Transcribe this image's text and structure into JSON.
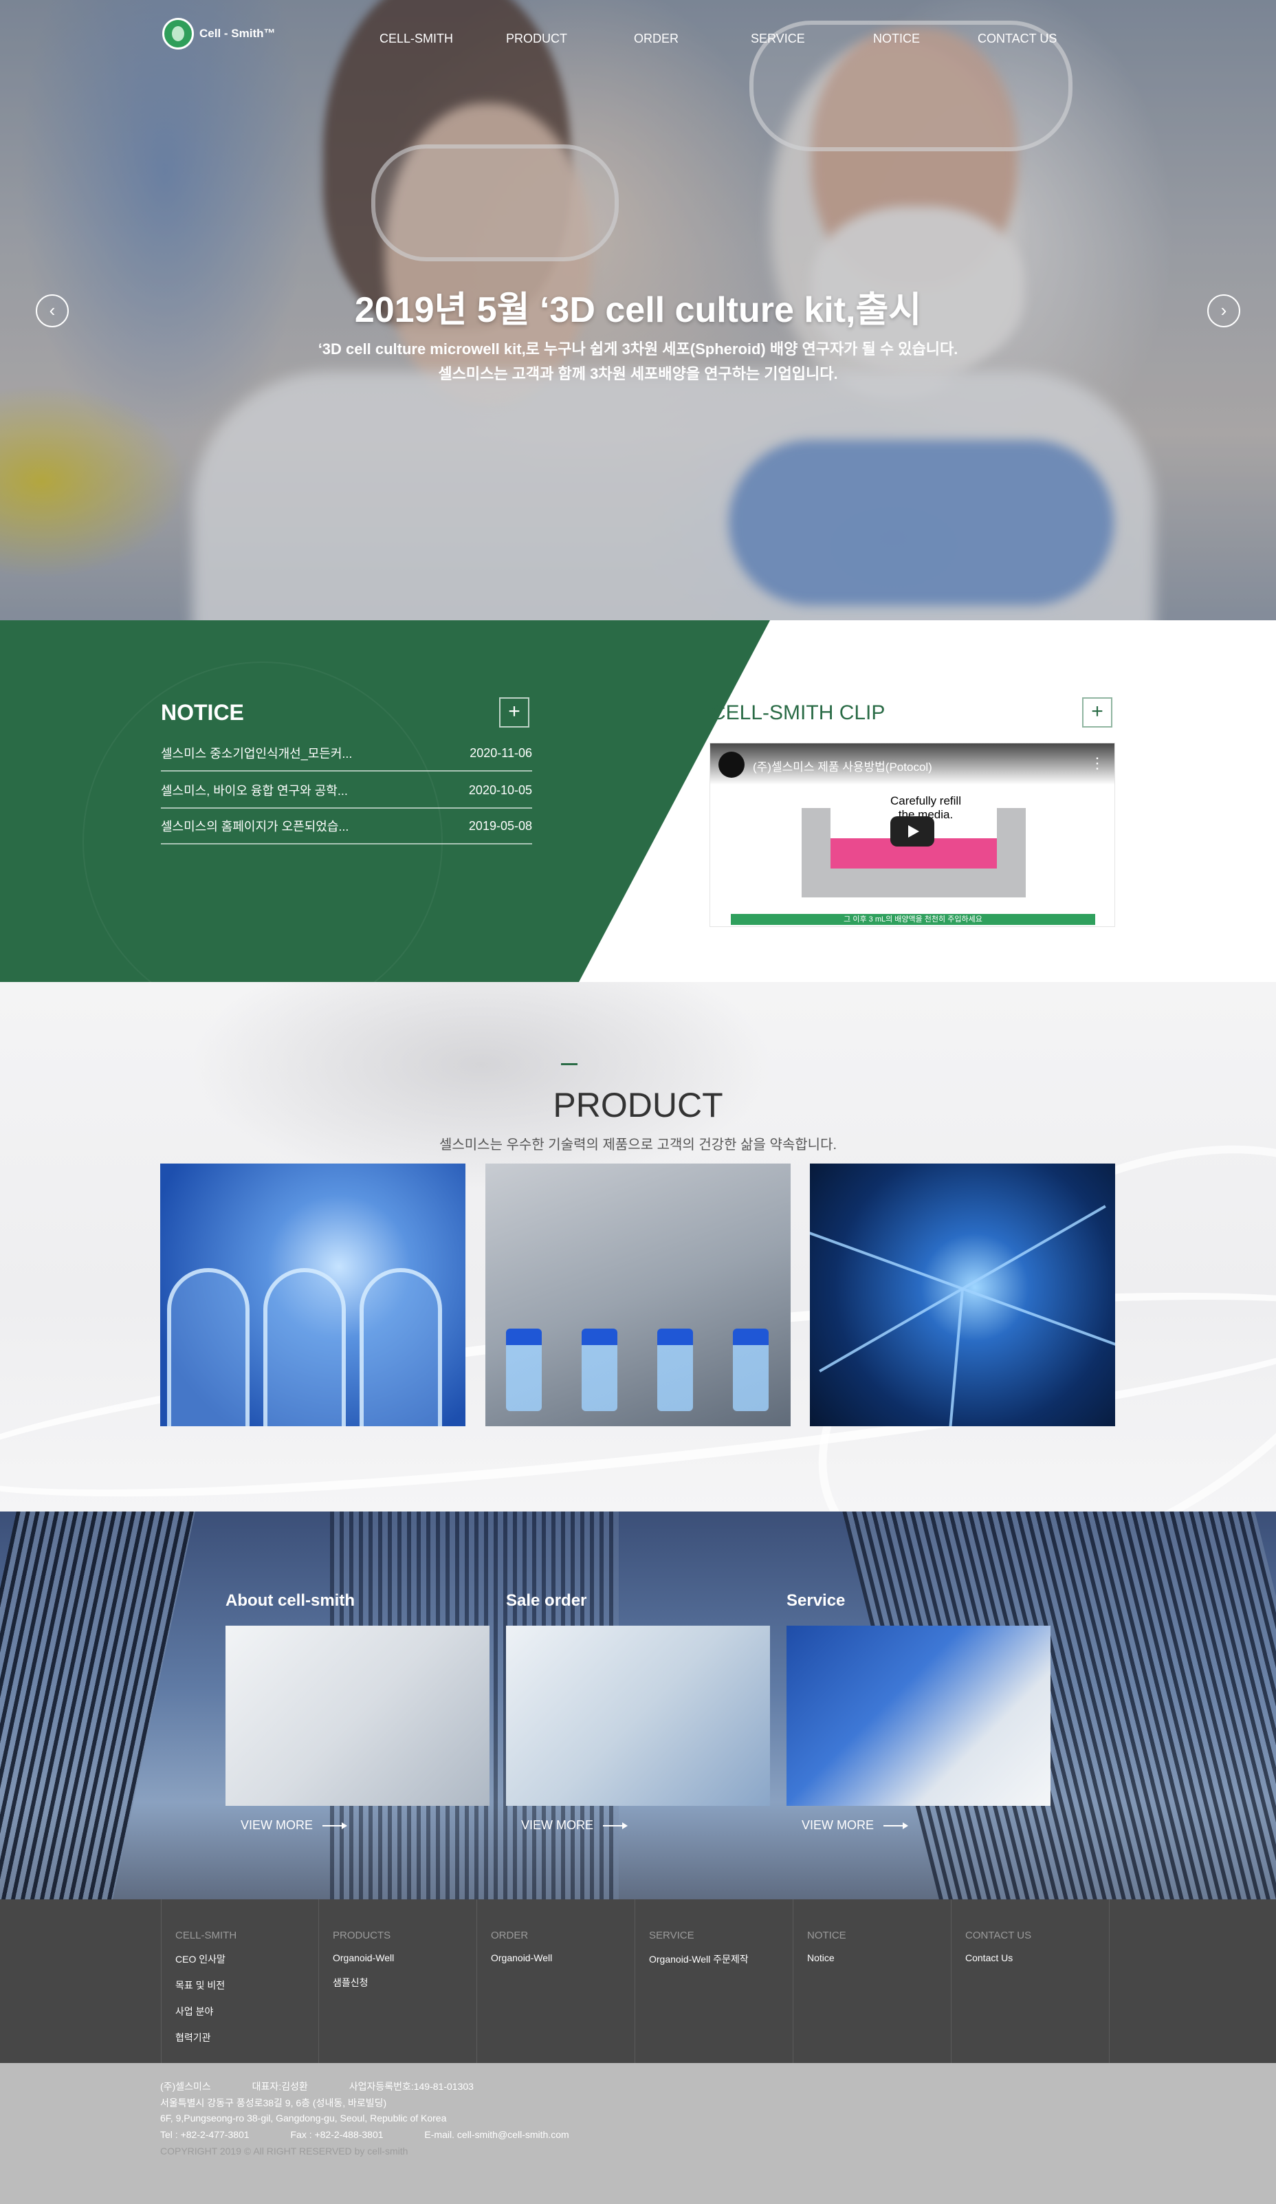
{
  "brand": {
    "name": "Cell - Smith™"
  },
  "nav": [
    "CELL-SMITH",
    "PRODUCT",
    "ORDER",
    "SERVICE",
    "NOTICE",
    "CONTACT US"
  ],
  "hero": {
    "title": "2019년 5월 ‘3D cell culture kit,출시",
    "line1": "‘3D cell culture microwell kit,로 누구나 쉽게 3차원 세포(Spheroid) 배양 연구자가 될 수 있습니다.",
    "line2": "셀스미스는 고객과 함께 3차원 세포배양을 연구하는 기업입니다.",
    "prev": "‹",
    "next": "›"
  },
  "notice": {
    "title": "NOTICE",
    "more": "+",
    "items": [
      {
        "title": "셀스미스 중소기업인식개선_모든커...",
        "date": "2020-11-06"
      },
      {
        "title": "셀스미스, 바이오 융합 연구와 공학...",
        "date": "2020-10-05"
      },
      {
        "title": "셀스미스의 홈페이지가 오픈되었습...",
        "date": "2019-05-08"
      }
    ]
  },
  "clip": {
    "title": "CELL-SMITH CLIP",
    "more": "+",
    "video_title": "(주)셀스미스 제품 사용방법(Potocol)",
    "video_menu": "⋮",
    "overlay_text1": "Carefully refill",
    "overlay_text2": "the media.",
    "caption": "그 이후 3 mL의 배양액을 천천히 주입하세요"
  },
  "product": {
    "title": "PRODUCT",
    "subtitle": "셀스미스는 우수한 기술력의 제품으로 고객의 건강한 삶을 약속합니다."
  },
  "info": {
    "cards": [
      {
        "title": "About cell-smith",
        "more": "VIEW MORE"
      },
      {
        "title": "Sale order",
        "more": "VIEW MORE"
      },
      {
        "title": "Service",
        "more": "VIEW MORE"
      }
    ]
  },
  "footer_nav": [
    {
      "heading": "CELL-SMITH",
      "items": [
        "CEO 인사말",
        "목표 및 비전",
        "사업 분야",
        "협력기관"
      ]
    },
    {
      "heading": "PRODUCTS",
      "items": [
        "Organoid-Well",
        "샘플신청"
      ]
    },
    {
      "heading": "ORDER",
      "items": [
        "Organoid-Well"
      ]
    },
    {
      "heading": "SERVICE",
      "items": [
        "Organoid-Well 주문제작"
      ]
    },
    {
      "heading": "NOTICE",
      "items": [
        "Notice"
      ]
    },
    {
      "heading": "CONTACT US",
      "items": [
        "Contact Us"
      ]
    }
  ],
  "footer": {
    "company": "(주)셀스미스",
    "ceo": "대표자:김성환",
    "biz_no": "사업자등록번호:149-81-01303",
    "address_kr": "서울특별시 강동구 풍성로38길 9, 6층 (성내동, 바로빌딩)",
    "address_en": "6F, 9,Pungseong-ro 38-gil, Gangdong-gu, Seoul, Republic of Korea",
    "tel": "Tel : +82-2-477-3801",
    "fax": "Fax : +82-2-488-3801",
    "email": "E-mail. cell-smith@cell-smith.com",
    "copyright": "COPYRIGHT 2019 © All RIGHT RESERVED by cell-smith"
  }
}
